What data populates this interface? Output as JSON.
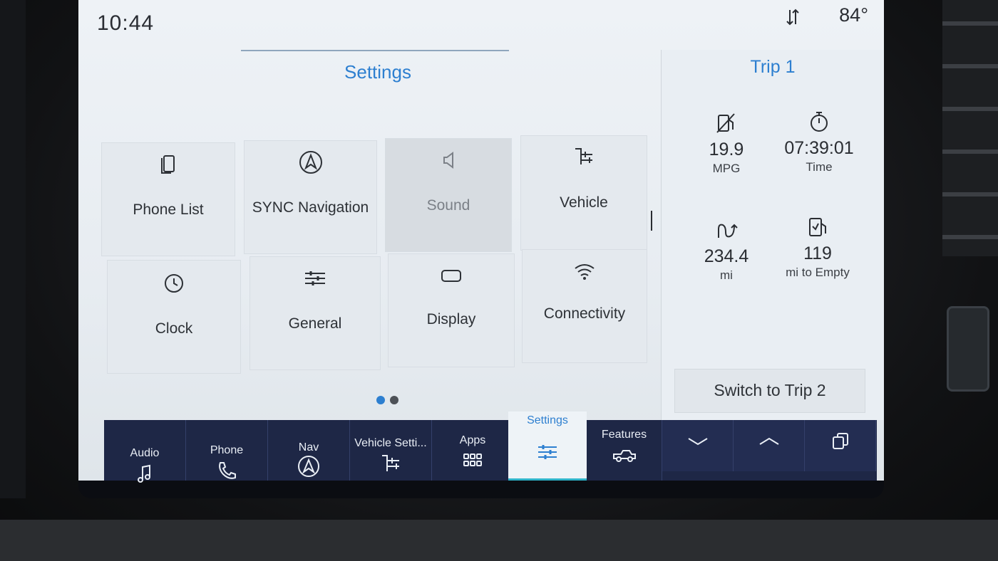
{
  "status": {
    "time": "10:44",
    "temperature": "84°"
  },
  "settings": {
    "title": "Settings",
    "tiles": [
      {
        "label": "Phone List",
        "icon": "phone-list-icon"
      },
      {
        "label": "SYNC Navigation",
        "icon": "navigation-arrow-icon"
      },
      {
        "label": "Sound",
        "icon": "speaker-icon"
      },
      {
        "label": "Vehicle",
        "icon": "vehicle-settings-icon"
      },
      {
        "label": "Clock",
        "icon": "clock-icon"
      },
      {
        "label": "General",
        "icon": "sliders-icon"
      },
      {
        "label": "Display",
        "icon": "display-icon"
      },
      {
        "label": "Connectivity",
        "icon": "wifi-icon"
      }
    ],
    "page_indicator": {
      "current": 1,
      "total": 2
    }
  },
  "trip": {
    "title": "Trip 1",
    "metrics": [
      {
        "value": "19.9",
        "unit": "MPG",
        "icon": "fuel-economy-icon"
      },
      {
        "value": "07:39:01",
        "unit": "Time",
        "icon": "stopwatch-icon"
      },
      {
        "value": "234.4",
        "unit": "mi",
        "icon": "distance-icon"
      },
      {
        "value": "119",
        "unit": "mi to Empty",
        "icon": "fuel-pump-icon"
      }
    ],
    "switch_label": "Switch to Trip 2"
  },
  "nav": {
    "items": [
      {
        "label": "Audio",
        "icon": "music-note-icon"
      },
      {
        "label": "Phone",
        "icon": "phone-handset-icon"
      },
      {
        "label": "Nav",
        "icon": "navigation-arrow-icon"
      },
      {
        "label": "Vehicle Setti...",
        "icon": "vehicle-settings-icon"
      },
      {
        "label": "Apps",
        "icon": "app-grid-icon"
      },
      {
        "label": "Settings",
        "icon": "sliders-icon",
        "active": true
      },
      {
        "label": "Features",
        "icon": "truck-icon"
      }
    ],
    "controls": [
      "chevron-down-icon",
      "chevron-up-icon",
      "overlapping-windows-icon"
    ]
  },
  "colors": {
    "accent": "#2d7fd0",
    "navbar": "#1e2746",
    "screen_bg": "#e7ecf1",
    "active_underline": "#2fb3c9"
  }
}
